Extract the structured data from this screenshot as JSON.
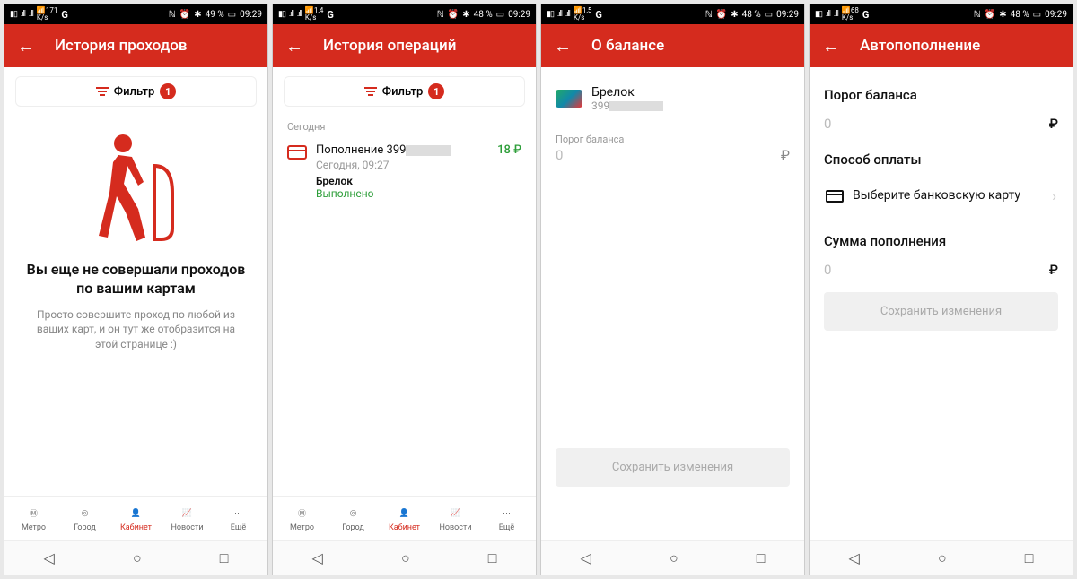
{
  "status": {
    "time": "09:29",
    "batt_pct": [
      "49 %",
      "48 %",
      "48 %",
      "48 %"
    ],
    "speed": [
      "171",
      "1,4",
      "1,5",
      "68"
    ],
    "speed_unit": "K/s"
  },
  "tabs": {
    "metro": "Метро",
    "city": "Город",
    "cabinet": "Кабинет",
    "news": "Новости",
    "more": "Ещё"
  },
  "screens": [
    {
      "title": "История проходов",
      "filter_label": "Фильтр",
      "filter_count": "1",
      "empty_heading": "Вы еще не совершали проходов по вашим картам",
      "empty_sub": "Просто совершите проход по любой из ваших карт, и он тут же отобразится на этой странице :)"
    },
    {
      "title": "История операций",
      "filter_label": "Фильтр",
      "filter_count": "1",
      "section": "Сегодня",
      "op_name_prefix": "Пополнение 399",
      "op_amount": "18 ₽",
      "op_date": "Сегодня, 09:27",
      "op_device": "Брелок",
      "op_status": "Выполнено"
    },
    {
      "title": "О балансе",
      "card_name": "Брелок",
      "card_num_prefix": "399",
      "threshold_label": "Порог баланса",
      "threshold_value": "0",
      "currency": "₽",
      "save": "Сохранить изменения"
    },
    {
      "title": "Автопополнение",
      "threshold_label": "Порог баланса",
      "threshold_value": "0",
      "method_label": "Способ оплаты",
      "method_value": "Выберите банковскую карту",
      "topup_label": "Сумма пополнения",
      "topup_value": "0",
      "currency": "₽",
      "save": "Сохранить изменения"
    }
  ]
}
